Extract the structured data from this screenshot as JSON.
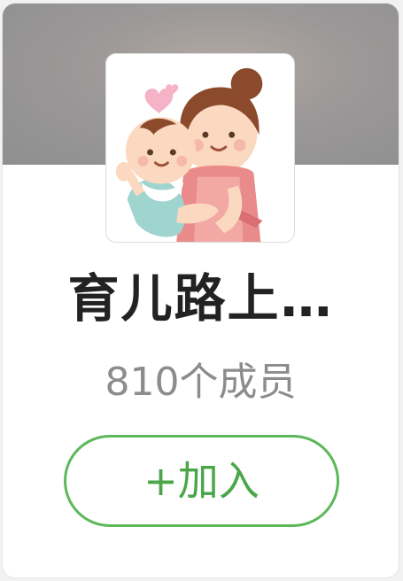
{
  "group": {
    "name": "育儿路上…",
    "member_count": "810个成员",
    "join_label": "+加入"
  },
  "icons": {
    "avatar": "mother-holding-baby-illustration"
  },
  "colors": {
    "accent_green": "#5cb85a",
    "title_text": "#222222",
    "secondary_text": "#8c8c8c",
    "cover_gray": "#8f8f8f"
  }
}
